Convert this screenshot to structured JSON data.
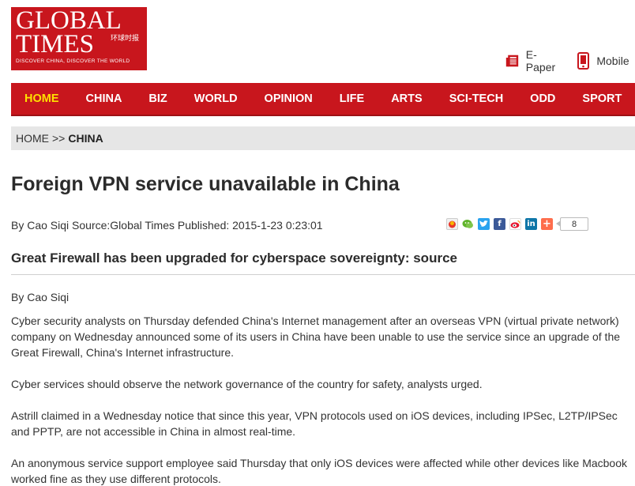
{
  "logo": {
    "line1": "GLOBAL",
    "line2": "TIMES",
    "chinese": "环球时报",
    "tagline": "DISCOVER CHINA, DISCOVER THE WORLD"
  },
  "header_links": {
    "epaper": "E-Paper",
    "mobile": "Mobile"
  },
  "nav": {
    "items": [
      "HOME",
      "CHINA",
      "BIZ",
      "WORLD",
      "OPINION",
      "LIFE",
      "ARTS",
      "SCI-TECH",
      "ODD",
      "SPORT"
    ],
    "active": "HOME"
  },
  "breadcrumb": {
    "home": "HOME",
    "separator": ">>",
    "current": "CHINA"
  },
  "article": {
    "title": "Foreign VPN service unavailable in China",
    "byline": "By Cao Siqi Source:Global Times Published: 2015-1-23 0:23:01",
    "share_count": "8",
    "subtitle": "Great Firewall has been upgraded for cyberspace sovereignty: source",
    "author": "By Cao Siqi",
    "paragraphs": [
      "Cyber security analysts on Thursday defended China's Internet management after an overseas VPN (virtual private network) company on Wednesday announced some of its users in China have been unable to use the service since an upgrade of the Great Firewall, China's Internet infrastructure.",
      "Cyber services should observe the network governance of the country for safety, analysts urged.",
      "Astrill claimed in a Wednesday notice that since this year, VPN protocols used on iOS devices, including IPSec, L2TP/IPSec and PPTP, are not accessible in China in almost real-time.",
      "An anonymous service support employee said Thursday that only iOS devices were affected while other devices like Macbook worked fine as they use different protocols."
    ]
  },
  "colors": {
    "brand_red": "#c8161d",
    "nav_active": "#ffe000",
    "breadcrumb_bg": "#e6e6e6"
  },
  "share_icons": [
    "qzone-icon",
    "wechat-icon",
    "twitter-icon",
    "facebook-icon",
    "weibo-icon",
    "linkedin-icon",
    "more-share-icon"
  ]
}
